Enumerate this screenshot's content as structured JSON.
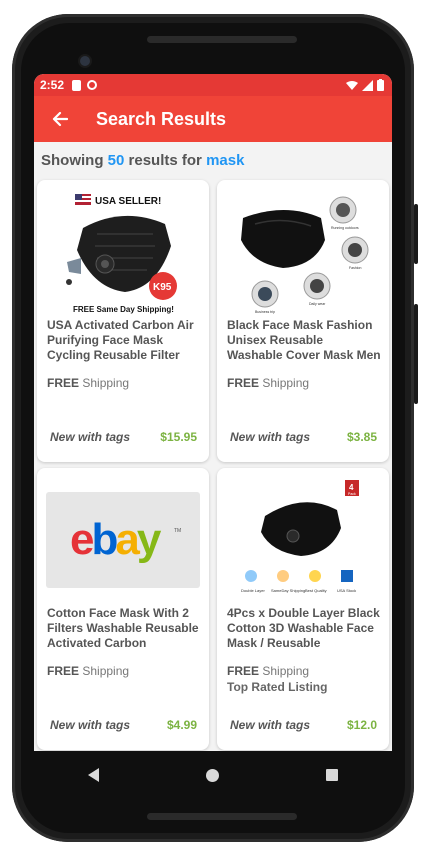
{
  "status_bar": {
    "time": "2:52"
  },
  "app_bar": {
    "title": "Search Results"
  },
  "summary": {
    "prefix": "Showing",
    "count": "50",
    "middle": "results for",
    "query": "mask"
  },
  "colors": {
    "accent": "#f04438",
    "status": "#e53935",
    "link": "#2196f3",
    "price": "#7cb342"
  },
  "items": [
    {
      "image_label": "USA SELLER!",
      "badge": "K95",
      "banner": "FREE Same Day Shipping!",
      "title": "USA Activated Carbon Air Purifying Face Mask Cycling Reusable Filter Ha...",
      "shipping_strong": "FREE",
      "shipping_rest": "Shipping",
      "extra": "",
      "condition": "New with tags",
      "price": "$15.95"
    },
    {
      "image_captions": [
        "Running outdoors",
        "Fashion",
        "Business trip",
        "Daily wear"
      ],
      "title": "Black Face Mask Fashion Unisex Reusable Washable Cover Mask Men Women ...",
      "shipping_strong": "FREE",
      "shipping_rest": "Shipping",
      "extra": "",
      "condition": "New with tags",
      "price": "$3.85"
    },
    {
      "logo": "ebay",
      "logo_tm": "TM",
      "title": "Cotton Face Mask  With  2 Filters Washable Reusable Activated Carbon respirator",
      "shipping_strong": "FREE",
      "shipping_rest": "Shipping",
      "extra": "",
      "condition": "New with tags",
      "price": "$4.99"
    },
    {
      "pack_badge": "4",
      "pack_label": "Pack",
      "feature_labels": [
        "Double Layer",
        "SameDay Shipping",
        "Best Quality",
        "USA Stock"
      ],
      "title": "4Pcs x Double Layer Black Cotton 3D Washable Face Mask / Reusable",
      "shipping_strong": "FREE",
      "shipping_rest": "Shipping",
      "extra": "Top Rated Listing",
      "condition": "New with tags",
      "price": "$12.0"
    }
  ]
}
